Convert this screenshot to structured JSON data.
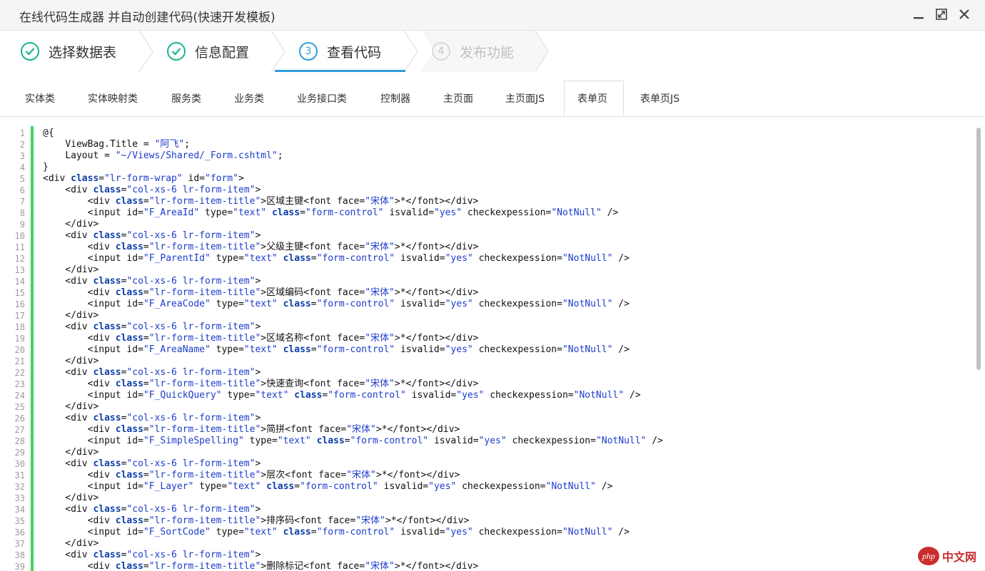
{
  "window": {
    "title": "在线代码生成器 并自动创建代码(快速开发模板)",
    "buttons": [
      "minimize-icon",
      "maximize-icon",
      "close-icon"
    ]
  },
  "steps": [
    {
      "num": "✓",
      "label": "选择数据表",
      "state": "done"
    },
    {
      "num": "✓",
      "label": "信息配置",
      "state": "done"
    },
    {
      "num": "3",
      "label": "查看代码",
      "state": "active"
    },
    {
      "num": "4",
      "label": "发布功能",
      "state": "pending"
    }
  ],
  "tabs": [
    {
      "label": "实体类"
    },
    {
      "label": "实体映射类"
    },
    {
      "label": "服务类"
    },
    {
      "label": "业务类"
    },
    {
      "label": "业务接口类"
    },
    {
      "label": "控制器"
    },
    {
      "label": "主页面"
    },
    {
      "label": "主页面JS"
    },
    {
      "label": "表单页",
      "active": true
    },
    {
      "label": "表单页JS"
    }
  ],
  "code_lines": [
    "@{",
    "    ViewBag.Title = \"阿飞\";",
    "    Layout = \"~/Views/Shared/_Form.cshtml\";",
    "}",
    "<div class=\"lr-form-wrap\" id=\"form\">",
    "    <div class=\"col-xs-6 lr-form-item\">",
    "        <div class=\"lr-form-item-title\">区域主键<font face=\"宋体\">*</font></div>",
    "        <input id=\"F_AreaId\" type=\"text\" class=\"form-control\" isvalid=\"yes\" checkexpession=\"NotNull\" />",
    "    </div>",
    "    <div class=\"col-xs-6 lr-form-item\">",
    "        <div class=\"lr-form-item-title\">父级主键<font face=\"宋体\">*</font></div>",
    "        <input id=\"F_ParentId\" type=\"text\" class=\"form-control\" isvalid=\"yes\" checkexpession=\"NotNull\" />",
    "    </div>",
    "    <div class=\"col-xs-6 lr-form-item\">",
    "        <div class=\"lr-form-item-title\">区域编码<font face=\"宋体\">*</font></div>",
    "        <input id=\"F_AreaCode\" type=\"text\" class=\"form-control\" isvalid=\"yes\" checkexpession=\"NotNull\" />",
    "    </div>",
    "    <div class=\"col-xs-6 lr-form-item\">",
    "        <div class=\"lr-form-item-title\">区域名称<font face=\"宋体\">*</font></div>",
    "        <input id=\"F_AreaName\" type=\"text\" class=\"form-control\" isvalid=\"yes\" checkexpession=\"NotNull\" />",
    "    </div>",
    "    <div class=\"col-xs-6 lr-form-item\">",
    "        <div class=\"lr-form-item-title\">快速查询<font face=\"宋体\">*</font></div>",
    "        <input id=\"F_QuickQuery\" type=\"text\" class=\"form-control\" isvalid=\"yes\" checkexpession=\"NotNull\" />",
    "    </div>",
    "    <div class=\"col-xs-6 lr-form-item\">",
    "        <div class=\"lr-form-item-title\">简拼<font face=\"宋体\">*</font></div>",
    "        <input id=\"F_SimpleSpelling\" type=\"text\" class=\"form-control\" isvalid=\"yes\" checkexpession=\"NotNull\" />",
    "    </div>",
    "    <div class=\"col-xs-6 lr-form-item\">",
    "        <div class=\"lr-form-item-title\">层次<font face=\"宋体\">*</font></div>",
    "        <input id=\"F_Layer\" type=\"text\" class=\"form-control\" isvalid=\"yes\" checkexpession=\"NotNull\" />",
    "    </div>",
    "    <div class=\"col-xs-6 lr-form-item\">",
    "        <div class=\"lr-form-item-title\">排序码<font face=\"宋体\">*</font></div>",
    "        <input id=\"F_SortCode\" type=\"text\" class=\"form-control\" isvalid=\"yes\" checkexpession=\"NotNull\" />",
    "    </div>",
    "    <div class=\"col-xs-6 lr-form-item\">",
    "        <div class=\"lr-form-item-title\">删除标记<font face=\"宋体\">*</font></div>"
  ],
  "watermark": {
    "logo": "php",
    "text": "中文网"
  },
  "colors": {
    "done": "#1ab394",
    "active": "#2f9ed8",
    "pending": "#d9d9d9",
    "gutter_bar": "#3fd360",
    "keyword": "#0d3ea8",
    "string": "#1c3ccc"
  }
}
